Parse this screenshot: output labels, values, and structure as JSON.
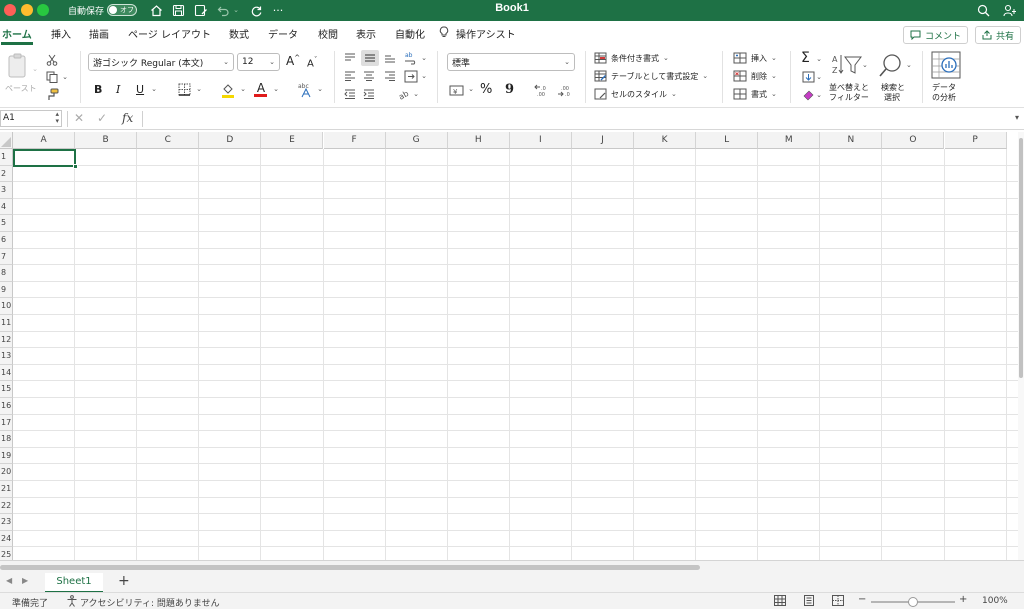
{
  "titlebar": {
    "autosave_label": "自動保存",
    "autosave_state": "オフ",
    "title": "Book1",
    "bg_color": "#1e7145",
    "icons": [
      "home-icon",
      "save-icon",
      "save-as-icon",
      "undo-icon",
      "redo-icon",
      "more-icon",
      "search-icon",
      "share-person-icon"
    ]
  },
  "tabs": [
    "ホーム",
    "挿入",
    "描画",
    "ページ レイアウト",
    "数式",
    "データ",
    "校閲",
    "表示",
    "自動化",
    "操作アシスト"
  ],
  "active_tab": "ホーム",
  "header_buttons": {
    "comment": "コメント",
    "share": "共有"
  },
  "ribbon": {
    "clipboard": {
      "paste": "ペースト"
    },
    "font": {
      "name": "游ゴシック Regular (本文)",
      "size": "12",
      "bold": "B",
      "italic": "I",
      "underline": "U",
      "grow": "A",
      "shrink": "A",
      "fill": "A"
    },
    "number": {
      "format": "標準",
      "percent": "%",
      "comma": "9"
    },
    "styles": {
      "conditional": "条件付き書式",
      "table": "テーブルとして書式設定",
      "cell": "セルのスタイル"
    },
    "cells": {
      "insert": "挿入",
      "delete": "削除",
      "format": "書式"
    },
    "editing": {
      "sum": "Σ",
      "sort_line1": "並べ替えと",
      "sort_line2": "フィルター",
      "find_line1": "検索と",
      "find_line2": "選択"
    },
    "analysis": {
      "line1": "データ",
      "line2": "の分析"
    }
  },
  "formula_bar": {
    "cell_ref": "A1",
    "fx": "fx",
    "value": ""
  },
  "columns": [
    "A",
    "B",
    "C",
    "D",
    "E",
    "F",
    "G",
    "H",
    "I",
    "J",
    "K",
    "L",
    "M",
    "N",
    "O",
    "P"
  ],
  "rows": [
    "1",
    "2",
    "3",
    "4",
    "5",
    "6",
    "7",
    "8",
    "9",
    "10",
    "11",
    "12",
    "13",
    "14",
    "15",
    "16",
    "17",
    "18",
    "19",
    "20",
    "21",
    "22",
    "23",
    "24",
    "25"
  ],
  "sheet_tabs": [
    "Sheet1"
  ],
  "add_sheet": "+",
  "status": {
    "ready": "準備完了",
    "accessibility": "アクセシビリティ: 問題ありません",
    "zoom": "100%",
    "zoom_level": 100,
    "zoom_minus": "−",
    "zoom_plus": "+"
  }
}
